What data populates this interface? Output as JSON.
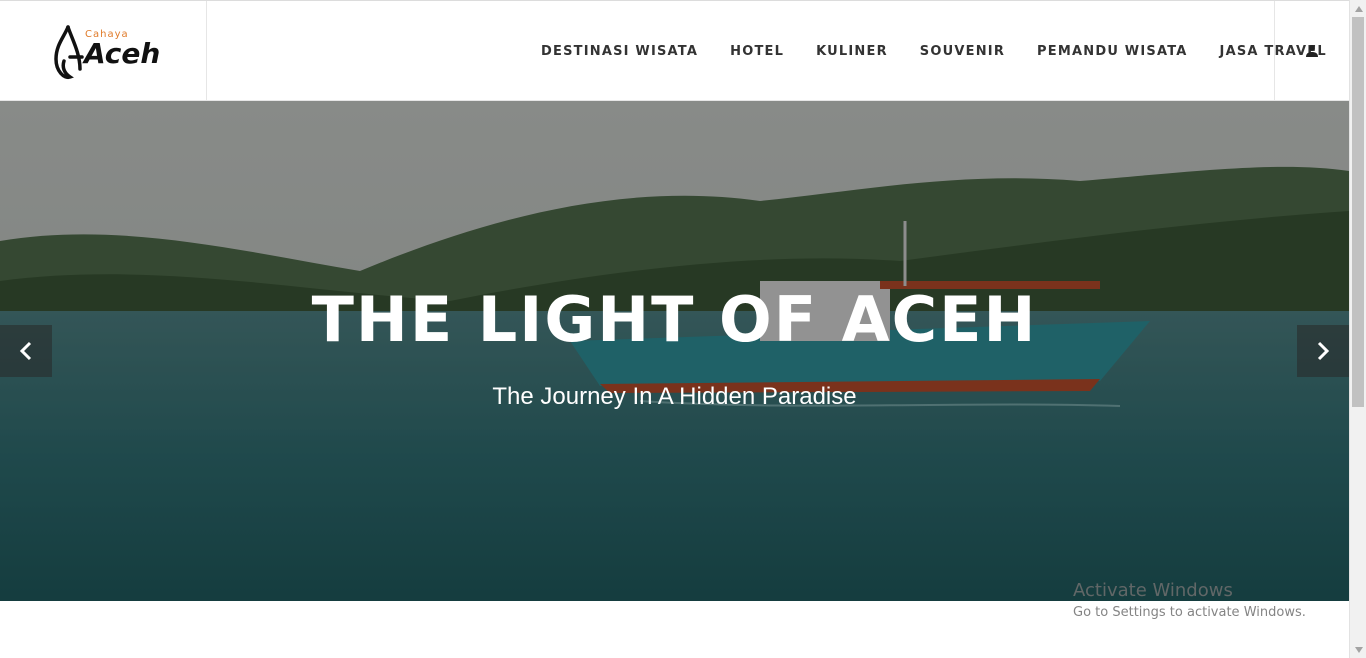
{
  "brand": {
    "logo_small": "Cahaya",
    "logo_main": "Aceh"
  },
  "nav": {
    "items": [
      {
        "label": "DESTINASI WISATA"
      },
      {
        "label": "HOTEL"
      },
      {
        "label": "KULINER"
      },
      {
        "label": "SOUVENIR"
      },
      {
        "label": "PEMANDU WISATA"
      },
      {
        "label": "JASA TRAVEL"
      }
    ],
    "user_icon": "user-icon"
  },
  "hero": {
    "title": "THE LIGHT OF ACEH",
    "subtitle": "The Journey In A Hidden Paradise",
    "prev_icon": "chevron-left-icon",
    "next_icon": "chevron-right-icon"
  },
  "watermark": {
    "title": "Activate Windows",
    "subtitle": "Go to Settings to activate Windows."
  },
  "colors": {
    "accent": "#e07b2a",
    "nav_text": "#333333",
    "sea": "#3c6f72",
    "hills": "#3e5c3a"
  }
}
